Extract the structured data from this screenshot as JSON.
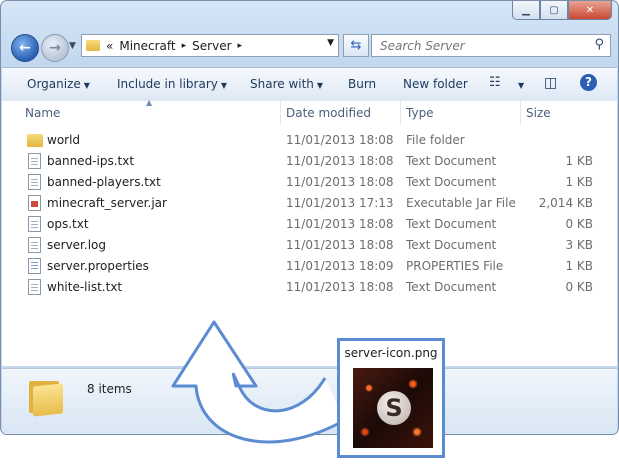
{
  "window": {
    "caption_buttons": [
      "minimize-icon",
      "maximize-icon",
      "close-icon"
    ]
  },
  "address_bar": {
    "overflow": "«",
    "path": [
      "Minecraft",
      "Server"
    ],
    "separator": "▸"
  },
  "search": {
    "placeholder": "Search Server"
  },
  "toolbar": {
    "organize": "Organize",
    "include_in_library": "Include in library",
    "share_with": "Share with",
    "burn": "Burn",
    "new_folder": "New folder"
  },
  "columns": {
    "name": "Name",
    "date_modified": "Date modified",
    "type": "Type",
    "size": "Size"
  },
  "files": [
    {
      "name": "world",
      "date": "11/01/2013 18:08",
      "type": "File folder",
      "size": "",
      "icon": "folder-icon"
    },
    {
      "name": "banned-ips.txt",
      "date": "11/01/2013 18:08",
      "type": "Text Document",
      "size": "1 KB",
      "icon": "text-document-icon"
    },
    {
      "name": "banned-players.txt",
      "date": "11/01/2013 18:08",
      "type": "Text Document",
      "size": "1 KB",
      "icon": "text-document-icon"
    },
    {
      "name": "minecraft_server.jar",
      "date": "11/01/2013 17:13",
      "type": "Executable Jar File",
      "size": "2,014 KB",
      "icon": "jar-file-icon"
    },
    {
      "name": "ops.txt",
      "date": "11/01/2013 18:08",
      "type": "Text Document",
      "size": "0 KB",
      "icon": "text-document-icon"
    },
    {
      "name": "server.log",
      "date": "11/01/2013 18:08",
      "type": "Text Document",
      "size": "3 KB",
      "icon": "text-document-icon"
    },
    {
      "name": "server.properties",
      "date": "11/01/2013 18:09",
      "type": "PROPERTIES File",
      "size": "1 KB",
      "icon": "properties-file-icon"
    },
    {
      "name": "white-list.txt",
      "date": "11/01/2013 18:08",
      "type": "Text Document",
      "size": "0 KB",
      "icon": "text-document-icon"
    }
  ],
  "details_pane": {
    "item_count": "8 items"
  },
  "overlay": {
    "icon_filename": "server-icon.png",
    "icon_letter": "S"
  },
  "colors": {
    "arrow": "#5b8bd0",
    "accent": "#2b5fb3"
  }
}
